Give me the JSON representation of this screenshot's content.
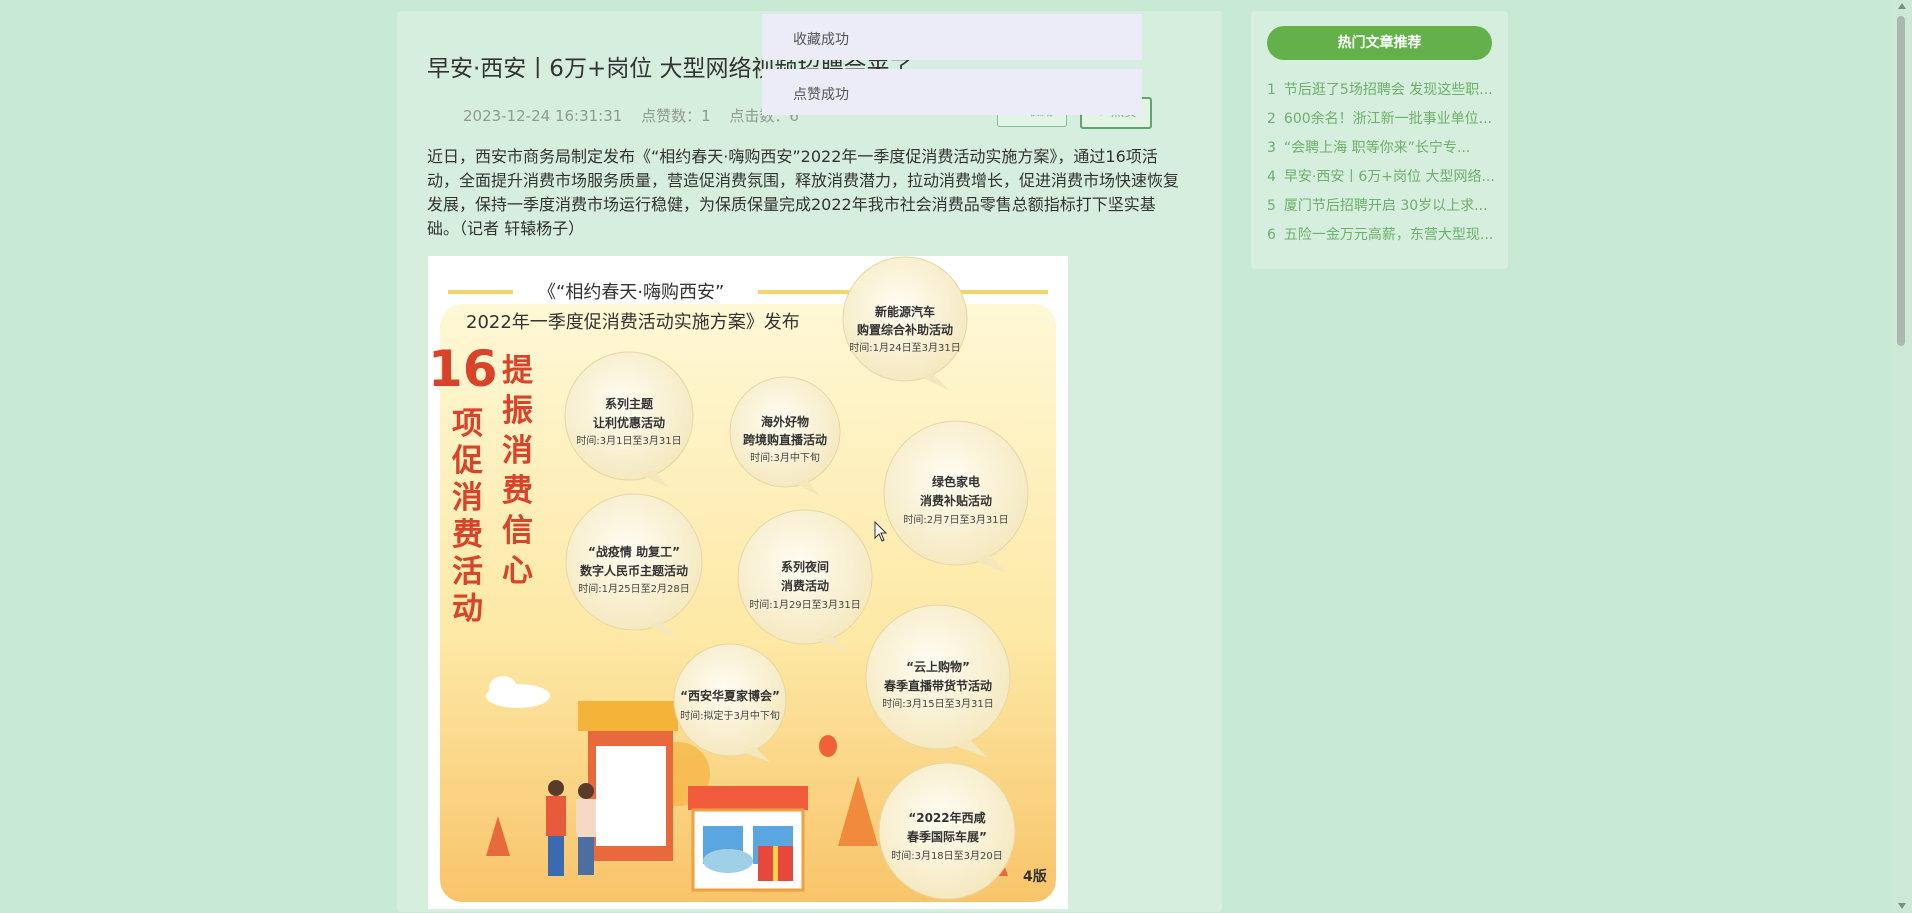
{
  "article": {
    "title": "早安·西安丨6万+岗位 大型网络视频招聘会来了",
    "date": "2023-12-24 16:31:31",
    "likes": "点赞数：1",
    "clicks": "点击数：6",
    "collect_label": "收藏",
    "like_label": "点赞",
    "body": "近日，西安市商务局制定发布《“相约春天·嗨购西安”2022年一季度促消费活动实施方案》，通过16项活动，全面提升消费市场服务质量，营造促消费氛围，释放消费潜力，拉动消费增长，促进消费市场快速恢复发展，保持一季度消费市场运行稳健，为保质保量完成2022年我市社会消费品零售总额指标打下坚实基础。（记者 轩辕杨子）"
  },
  "toasts": [
    "收藏成功",
    "点赞成功"
  ],
  "poster": {
    "title_line1": "《“相约春天·嗨购西安”",
    "title_line2": "2022年一季度促消费活动实施方案》发布",
    "vertical_left": "16项促消费活动",
    "vertical_right": "提振消费信心",
    "badge": "4版",
    "bubbles": [
      {
        "line1": "新能源汽车",
        "line2": "购置综合补助活动",
        "time": "时间:1月24日至3月31日"
      },
      {
        "line1": "系列主题",
        "line2": "让利优惠活动",
        "time": "时间:3月1日至3月31日"
      },
      {
        "line1": "海外好物",
        "line2": "跨境购直播活动",
        "time": "时间:3月中下旬"
      },
      {
        "line1": "绿色家电",
        "line2": "消费补贴活动",
        "time": "时间:2月7日至3月31日"
      },
      {
        "line1": "“战疫情 助复工”",
        "line2": "数字人民币主题活动",
        "time": "时间:1月25日至2月28日"
      },
      {
        "line1": "系列夜间",
        "line2": "消费活动",
        "time": "时间:1月29日至3月31日"
      },
      {
        "line1": "“云上购物”",
        "line2": "春季直播带货节活动",
        "time": "时间:3月15日至3月31日"
      },
      {
        "line1": "“西安华夏家博会”",
        "line2": "",
        "time": "时间:拟定于3月中下旬"
      },
      {
        "line1": "“2022年西咸",
        "line2": "春季国际车展”",
        "time": "时间:3月18日至3月20日"
      }
    ]
  },
  "sidebar": {
    "header": "热门文章推荐",
    "items": [
      {
        "num": "1",
        "label": "节后逛了5场招聘会 发现这些职..."
      },
      {
        "num": "2",
        "label": "600余名！浙江新一批事业单位..."
      },
      {
        "num": "3",
        "label": "“会聘上海 职等你来”长宁专..."
      },
      {
        "num": "4",
        "label": "早安·西安丨6万+岗位 大型网络..."
      },
      {
        "num": "5",
        "label": "厦门节后招聘开启 30岁以上求..."
      },
      {
        "num": "6",
        "label": "五险一金万元高薪，东营大型现..."
      }
    ]
  },
  "colors": {
    "background": "#c8e9d3",
    "panel": "#d6eedd",
    "accent": "#64b14b",
    "link": "#6db06b",
    "poster_title_red": "#d9432a"
  }
}
